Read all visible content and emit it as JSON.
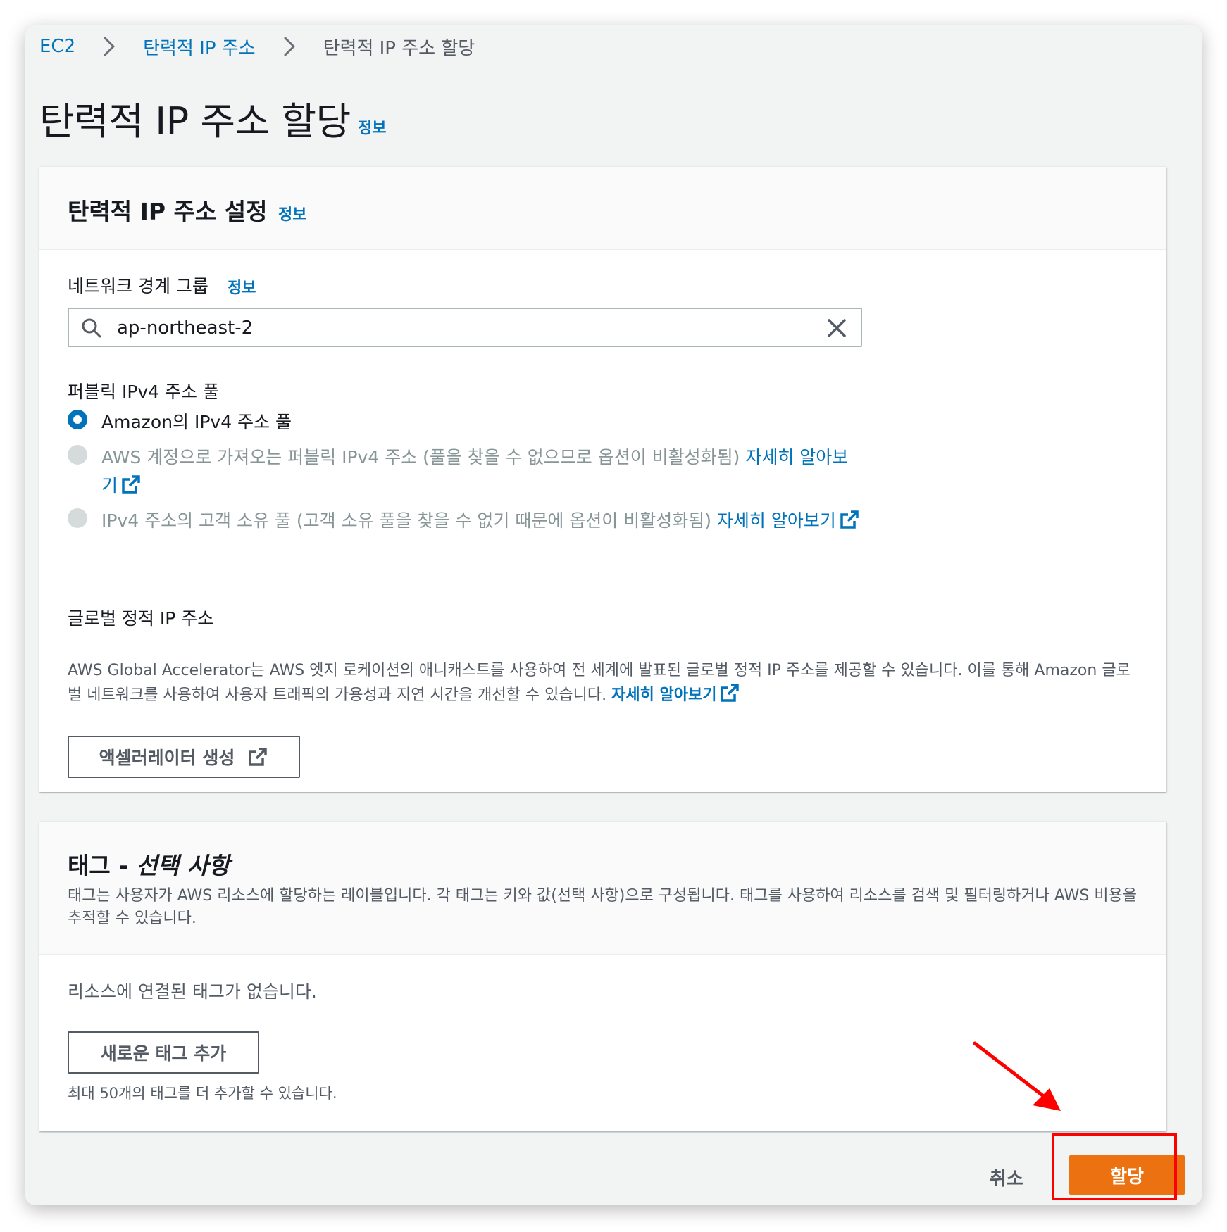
{
  "breadcrumb": {
    "items": [
      "EC2",
      "탄력적 IP 주소"
    ],
    "current": "탄력적 IP 주소 할당"
  },
  "page": {
    "title": "탄력적 IP 주소 할당",
    "info": "정보"
  },
  "settings_panel": {
    "title": "탄력적 IP 주소 설정",
    "info": "정보",
    "network_border_group": {
      "label": "네트워크 경계 그룹",
      "info": "정보",
      "value": "ap-northeast-2"
    },
    "public_ipv4_pool": {
      "label": "퍼블릭 IPv4 주소 풀",
      "options": [
        {
          "text": "Amazon의 IPv4 주소 풀",
          "selected": true,
          "disabled": false
        },
        {
          "text": "AWS 계정으로 가져오는 퍼블릭 IPv4 주소 (풀을 찾을 수 없으므로 옵션이 비활성화됨) ",
          "link": "자세히 알아보기",
          "selected": false,
          "disabled": true
        },
        {
          "text": "IPv4 주소의 고객 소유 풀 (고객 소유 풀을 찾을 수 없기 때문에 옵션이 비활성화됨) ",
          "link": "자세히 알아보기",
          "selected": false,
          "disabled": true
        }
      ]
    },
    "global_static": {
      "label": "글로벌 정적 IP 주소",
      "description": "AWS Global Accelerator는 AWS 엣지 로케이션의 애니캐스트를 사용하여 전 세계에 발표된 글로벌 정적 IP 주소를 제공할 수 있습니다. 이를 통해 Amazon 글로벌 네트워크를 사용하여 사용자 트래픽의 가용성과 지연 시간을 개선할 수 있습니다. ",
      "link": "자세히 알아보기",
      "button": "액셀러레이터 생성"
    }
  },
  "tags_panel": {
    "title_prefix": "태그 - ",
    "title_optional": "선택 사항",
    "description": "태그는 사용자가 AWS 리소스에 할당하는 레이블입니다. 각 태그는 키와 값(선택 사항)으로 구성됩니다. 태그를 사용하여 리소스를 검색 및 필터링하거나 AWS 비용을 추적할 수 있습니다.",
    "empty": "리소스에 연결된 태그가 없습니다.",
    "add_button": "새로운 태그 추가",
    "limit": "최대 50개의 태그를 더 추가할 수 있습니다."
  },
  "footer": {
    "cancel": "취소",
    "submit": "할당"
  },
  "colors": {
    "link": "#0073bb",
    "primary": "#ec7211",
    "annotation": "#ff0000"
  },
  "icons": [
    "chevron-right-icon",
    "search-icon",
    "close-icon",
    "external-link-icon",
    "red-arrow-annotation"
  ]
}
